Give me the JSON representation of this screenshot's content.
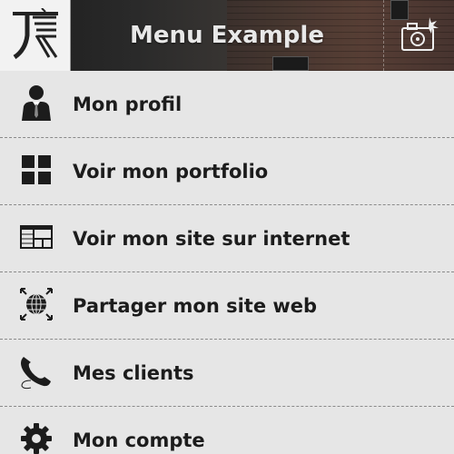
{
  "header": {
    "title": "Menu Example",
    "logo_icon": "logo-icon",
    "camera_icon": "camera-icon"
  },
  "menu": {
    "items": [
      {
        "label": "Mon profil",
        "icon": "user-icon"
      },
      {
        "label": "Voir mon portfolio",
        "icon": "grid-icon"
      },
      {
        "label": "Voir mon site sur internet",
        "icon": "website-icon"
      },
      {
        "label": "Partager mon site web",
        "icon": "globe-icon"
      },
      {
        "label": "Mes clients",
        "icon": "phone-icon"
      },
      {
        "label": "Mon compte",
        "icon": "gear-icon"
      }
    ]
  },
  "colors": {
    "background": "#e6e6e6",
    "text": "#1c1c1c",
    "header_text": "#e8e8e8",
    "divider": "#8a8a8a"
  }
}
